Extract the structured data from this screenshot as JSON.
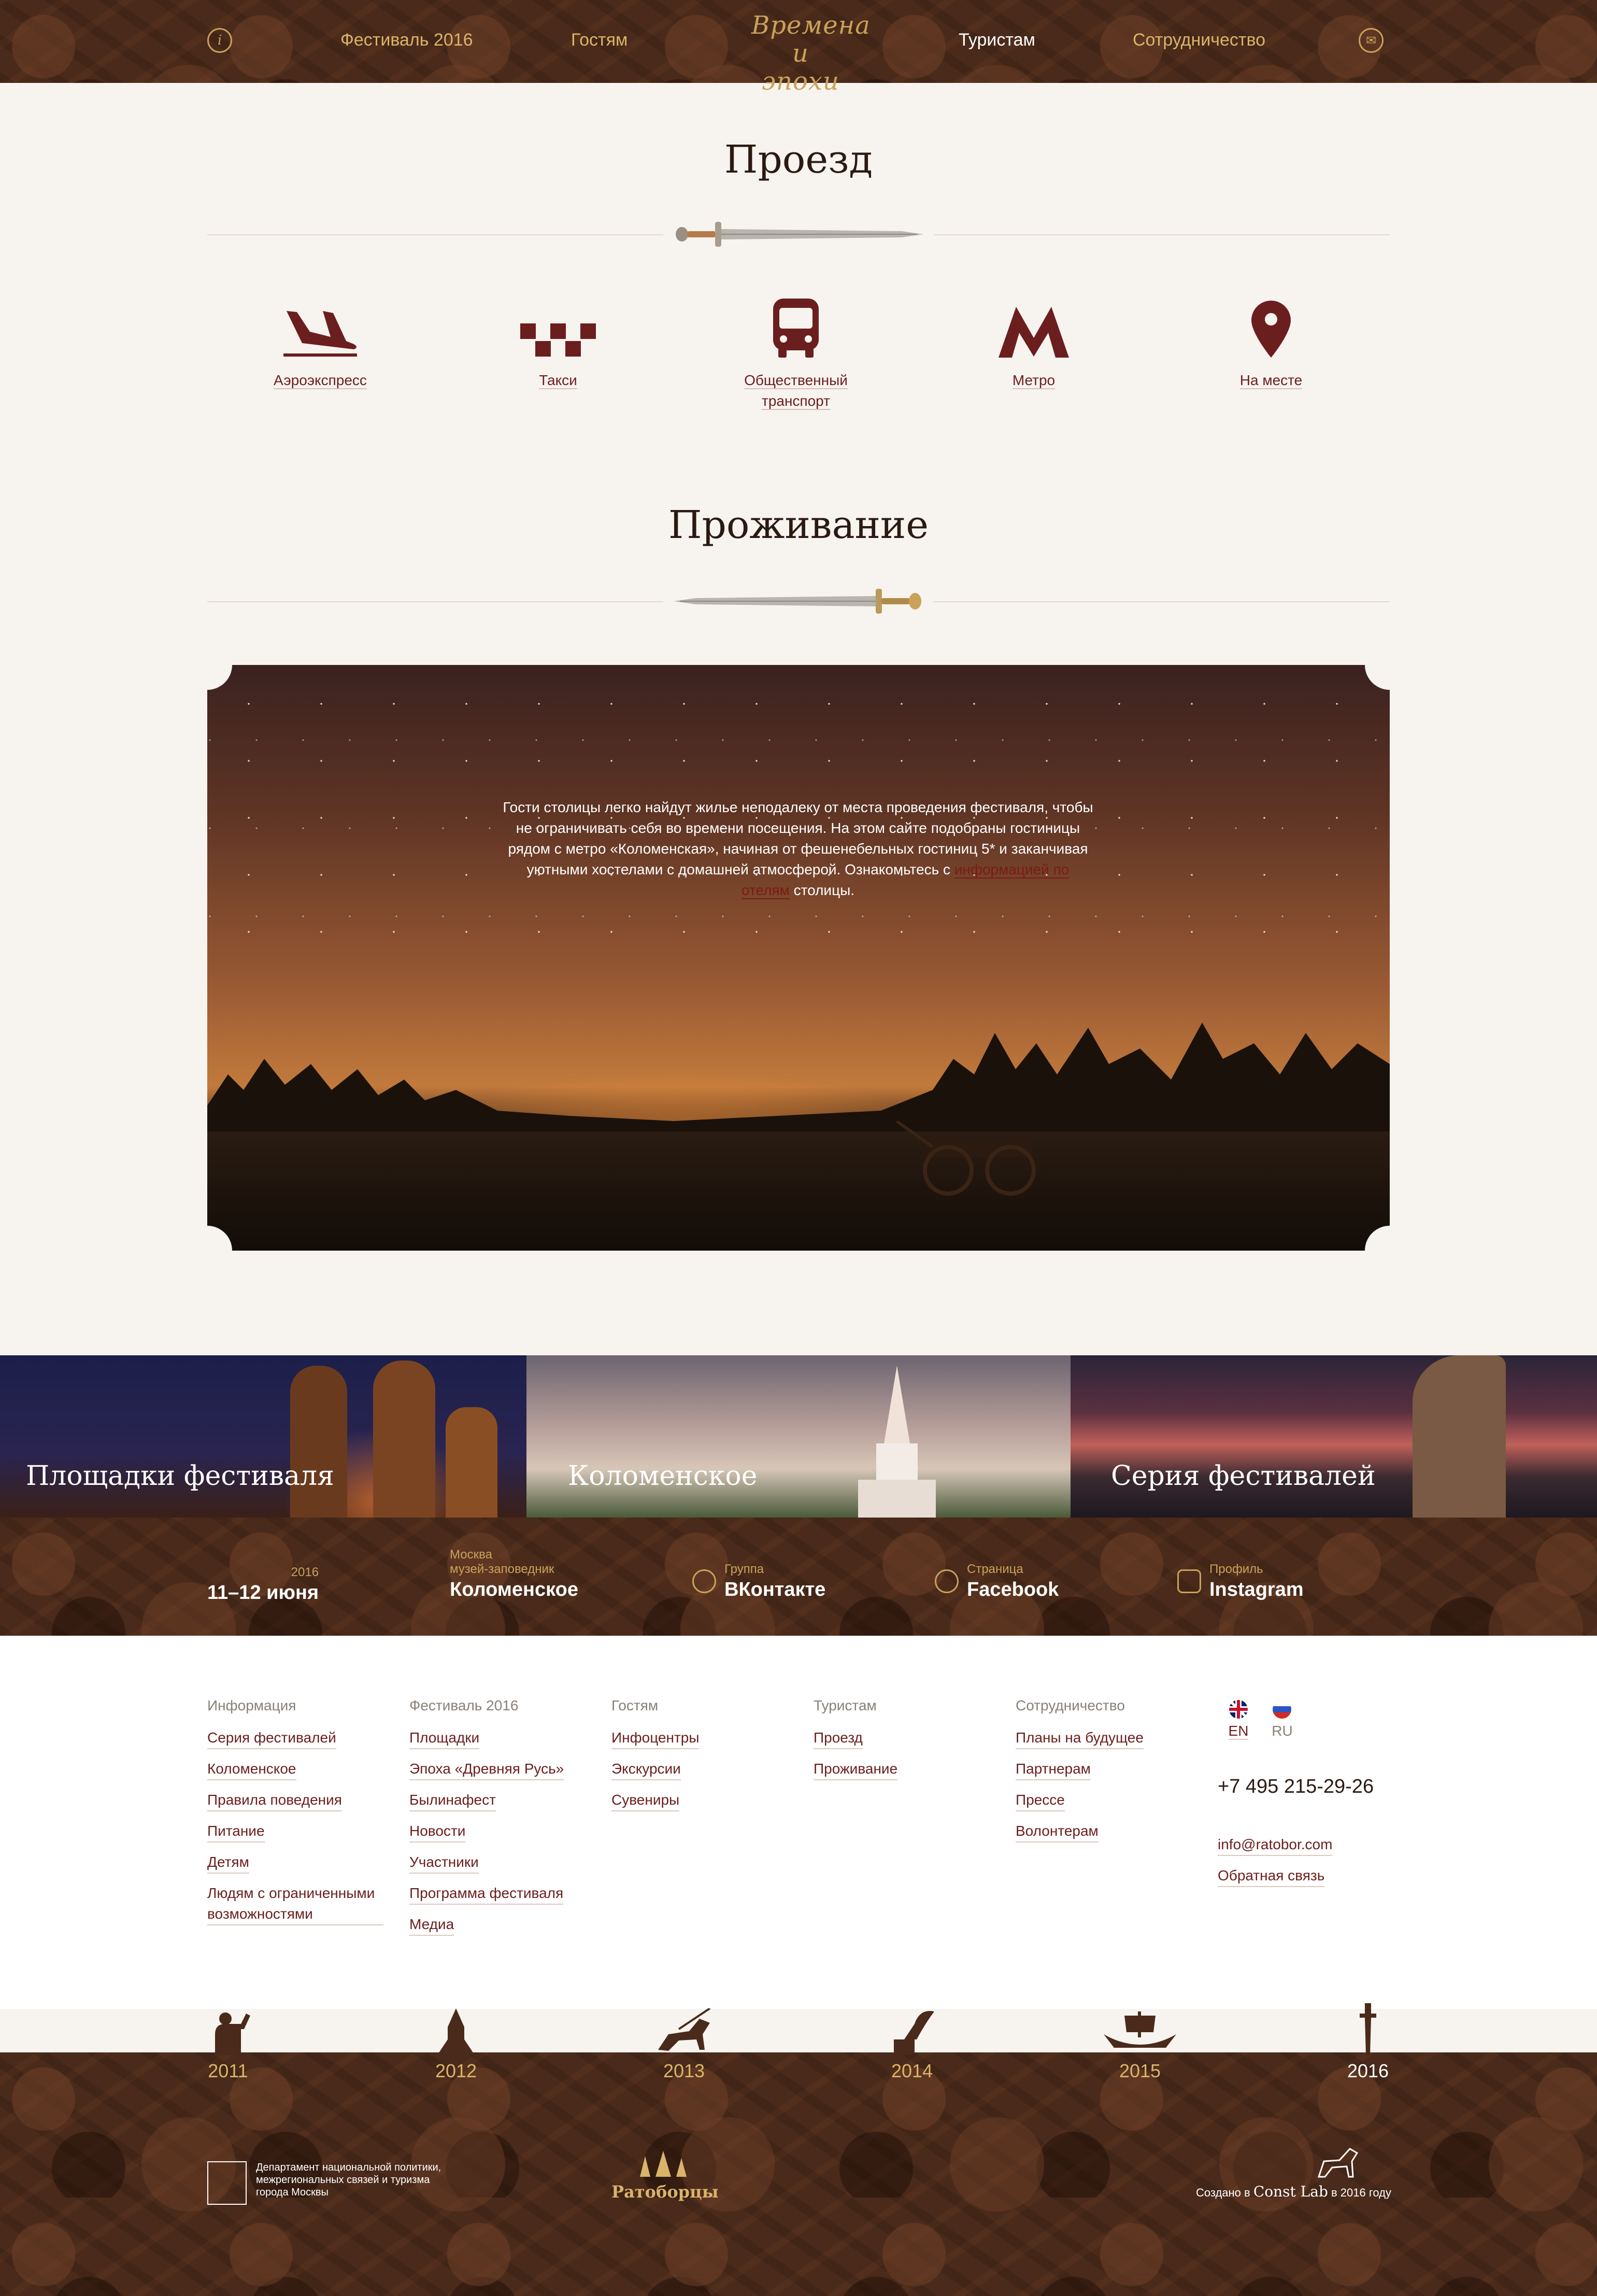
{
  "header": {
    "nav": [
      "Фестиваль 2016",
      "Гостям",
      "Туристам",
      "Сотрудничество"
    ],
    "active": "Туристам",
    "logo": [
      "Времена",
      "и эпохи"
    ]
  },
  "transport": {
    "title": "Проезд",
    "items": [
      {
        "icon": "airplane-icon",
        "label": "Аэроэкспресс"
      },
      {
        "icon": "taxi-icon",
        "label": "Такси"
      },
      {
        "icon": "bus-icon",
        "label": "Общественный транспорт"
      },
      {
        "icon": "metro-icon",
        "label": "Метро"
      },
      {
        "icon": "location-pin-icon",
        "label": "На месте"
      }
    ]
  },
  "accommodation": {
    "title": "Проживание",
    "text_before": "Гости столицы легко найдут жилье неподалеку от места проведения фестиваля, чтобы не ограничивать себя во времени посещения. На этом сайте подобраны гостиницы рядом с метро «Коломенская», начиная от фешенебельных гостиниц 5* и заканчивая уютными хостелами с домашней атмосферой. Ознакомьтесь с ",
    "link": "информацией по отелям",
    "text_after": " столицы."
  },
  "tiles": [
    "Площадки фестиваля",
    "Коломенское",
    "Серия фестивалей"
  ],
  "strip": [
    {
      "small": "2016",
      "big": "11–12 июня"
    },
    {
      "small": "Москва\nмузей-заповедник",
      "big": "Коломенское"
    },
    {
      "small": "Группа",
      "big": "ВКонтакте",
      "icon": "vk-icon"
    },
    {
      "small": "Страница",
      "big": "Facebook",
      "icon": "facebook-icon"
    },
    {
      "small": "Профиль",
      "big": "Instagram",
      "icon": "instagram-icon"
    }
  ],
  "footer": {
    "columns": [
      {
        "head": "Информация",
        "links": [
          "Серия фестивалей",
          "Коломенское",
          "Правила поведения",
          "Питание",
          "Детям",
          "Людям с ограниченными возможностями"
        ]
      },
      {
        "head": "Фестиваль 2016",
        "links": [
          "Площадки",
          "Эпоха «Древняя Русь»",
          "Былинафест",
          "Новости",
          "Участники",
          "Программа фестиваля",
          "Медиа"
        ]
      },
      {
        "head": "Гостям",
        "links": [
          "Инфоцентры",
          "Экскурсии",
          "Сувениры"
        ]
      },
      {
        "head": "Туристам",
        "links": [
          "Проезд",
          "Проживание"
        ]
      },
      {
        "head": "Сотрудничество",
        "links": [
          "Планы на будущее",
          "Партнерам",
          "Прессе",
          "Волонтерам"
        ]
      }
    ],
    "languages": [
      "EN",
      "RU"
    ],
    "phone": "+7 495 215-29-26",
    "email": "info@ratobor.com",
    "feedback": "Обратная связь"
  },
  "years": [
    "2011",
    "2012",
    "2013",
    "2014",
    "2015",
    "2016"
  ],
  "current_year": "2016",
  "bottom": {
    "dept": "Департамент национальной политики, межрегиональных связей и туризма города Москвы",
    "ratobor": "Ратоборцы",
    "made_prefix": "Создано в ",
    "made_brand": "Const Lab",
    "made_suffix": " в 2016 году"
  },
  "colors": {
    "accent": "#6b1e1e",
    "gold": "#c9a25a",
    "brown": "#4a2a1a",
    "background": "#f7f3ef"
  }
}
